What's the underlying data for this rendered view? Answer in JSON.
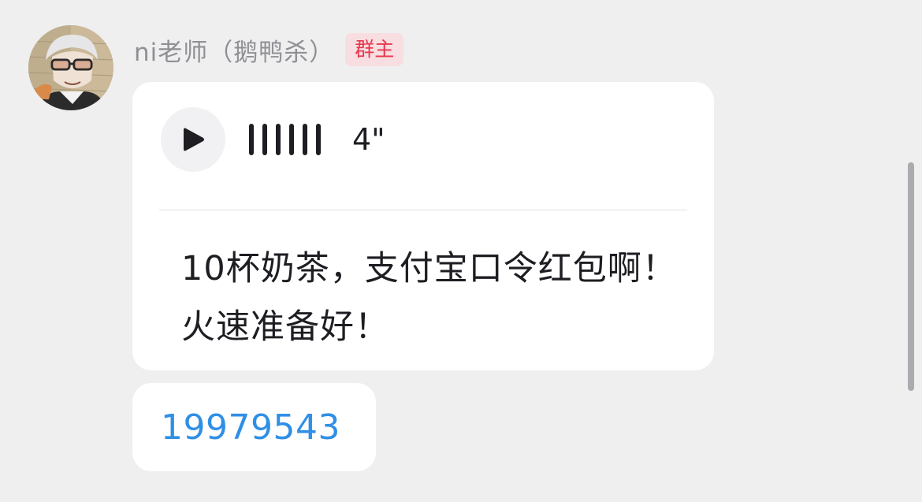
{
  "sender": {
    "name": "ni老师（鹅鸭杀）",
    "role_badge": "群主",
    "avatar_icon": "user-avatar-image"
  },
  "voice_message": {
    "play_icon": "play-icon",
    "duration": "4\"",
    "transcript": "10杯奶茶，支付宝口令红包啊！火速准备好！"
  },
  "number_message": {
    "text": "19979543"
  },
  "colors": {
    "background": "#efeff0",
    "bubble": "#ffffff",
    "badge_bg": "#f8dde1",
    "badge_text": "#e8374d",
    "link": "#2f8fe6"
  }
}
